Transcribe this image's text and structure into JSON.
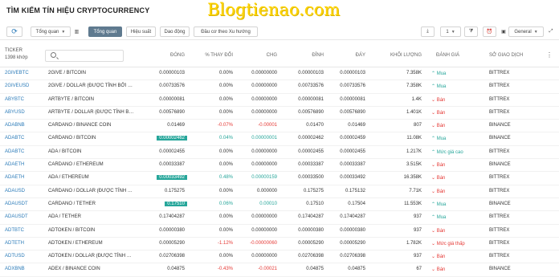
{
  "title": "TÌM KIẾM TÍN HIỆU CRYPTOCURRENCY",
  "watermark": "Blogtienao.com",
  "toolbar": {
    "overview_select": "Tổng quan",
    "tabs": [
      "Tổng quan",
      "Hiệu suất",
      "Dao động",
      "Đầu cơ theo Xu hướng"
    ],
    "interval": "1",
    "general_select": "General"
  },
  "header": {
    "ticker": "TICKER",
    "count": "1398 khớp",
    "columns": [
      "ĐÓNG",
      "% THAY ĐỔI",
      "CHG",
      "ĐỈNH",
      "ĐÁY",
      "KHỐI LƯỢNG",
      "ĐÁNH GIÁ",
      "SỞ GIAO DỊCH"
    ]
  },
  "rows": [
    {
      "sym": "2GIVEBTC",
      "desc": "2GIVE / BITCOIN",
      "last": "0.00000103",
      "chp": "0.00%",
      "chg": "0.00000000",
      "hi": "0.00000103",
      "lo": "0.00000103",
      "vol": "7.358K",
      "rat": "Mua",
      "exc": "BITTREX"
    },
    {
      "sym": "2GIVEUSD",
      "desc": "2GIVE / DOLLAR (ĐƯỢC TÍNH BỞI …",
      "last": "0.00733576",
      "chp": "0.00%",
      "chg": "0.00000000",
      "hi": "0.00733576",
      "lo": "0.00733576",
      "vol": "7.358K",
      "rat": "Mua",
      "exc": "BITTREX"
    },
    {
      "sym": "ABYBTC",
      "desc": "ARTBYTE / BITCOIN",
      "last": "0.00000081",
      "chp": "0.00%",
      "chg": "0.00000000",
      "hi": "0.00000081",
      "lo": "0.00000081",
      "vol": "1.4K",
      "rat": "Bán",
      "exc": "BITTREX"
    },
    {
      "sym": "ABYUSD",
      "desc": "ARTBYTE / DOLLAR (ĐƯỢC TÍNH B…",
      "last": "0.00576890",
      "chp": "0.00%",
      "chg": "0.00000000",
      "hi": "0.00576890",
      "lo": "0.00576890",
      "vol": "1.401K",
      "rat": "Bán",
      "exc": "BITTREX"
    },
    {
      "sym": "ADABNB",
      "desc": "CARDANO / BINANCE COIN",
      "last": "0.01469",
      "chp": "-0.07%",
      "chg": "-0.00001",
      "hi": "0.01470",
      "lo": "0.01469",
      "vol": "807",
      "rat": "Bán",
      "exc": "BINANCE"
    },
    {
      "sym": "ADABTC",
      "desc": "CARDANO / BITCOIN",
      "last": "0.00002462",
      "chp": "0.04%",
      "chg": "0.00000001",
      "hi": "0.00002462",
      "lo": "0.00002459",
      "vol": "11.08K",
      "rat": "Mua",
      "exc": "BINANCE"
    },
    {
      "sym": "ADABTC",
      "desc": "ADA / BITCOIN",
      "last": "0.00002455",
      "chp": "0.00%",
      "chg": "0.00000000",
      "hi": "0.00002455",
      "lo": "0.00002455",
      "vol": "1.217K",
      "rat": "Mức giá cao",
      "exc": "BITTREX"
    },
    {
      "sym": "ADAETH",
      "desc": "CARDANO / ETHEREUM",
      "last": "0.00033387",
      "chp": "0.00%",
      "chg": "0.00000000",
      "hi": "0.00033387",
      "lo": "0.00033387",
      "vol": "3.515K",
      "rat": "Bán",
      "exc": "BINANCE"
    },
    {
      "sym": "ADAETH",
      "desc": "ADA / ETHEREUM",
      "last": "0.00033492",
      "chp": "0.48%",
      "chg": "0.00000159",
      "hi": "0.00033500",
      "lo": "0.00033492",
      "vol": "16.358K",
      "rat": "Bán",
      "exc": "BITTREX"
    },
    {
      "sym": "ADAUSD",
      "desc": "CARDANO / DOLLAR (ĐƯỢC TÍNH …",
      "last": "0.175275",
      "chp": "0.00%",
      "chg": "0.000000",
      "hi": "0.175275",
      "lo": "0.175132",
      "vol": "7.71K",
      "rat": "Bán",
      "exc": "BITTREX"
    },
    {
      "sym": "ADAUSDT",
      "desc": "CARDANO / TETHER",
      "last": "0.17510",
      "chp": "0.06%",
      "chg": "0.00010",
      "hi": "0.17510",
      "lo": "0.17504",
      "vol": "11.553K",
      "rat": "Mua",
      "exc": "BINANCE"
    },
    {
      "sym": "ADAUSDT",
      "desc": "ADA / TETHER",
      "last": "0.17404287",
      "chp": "0.00%",
      "chg": "0.00000000",
      "hi": "0.17404287",
      "lo": "0.17404287",
      "vol": "937",
      "rat": "Mua",
      "exc": "BITTREX"
    },
    {
      "sym": "ADTBTC",
      "desc": "ADTOKEN / BITCOIN",
      "last": "0.00000380",
      "chp": "0.00%",
      "chg": "0.00000000",
      "hi": "0.00000380",
      "lo": "0.00000380",
      "vol": "937",
      "rat": "Bán",
      "exc": "BITTREX"
    },
    {
      "sym": "ADTETH",
      "desc": "ADTOKEN / ETHEREUM",
      "last": "0.00005290",
      "chp": "-1.12%",
      "chg": "-0.00000060",
      "hi": "0.00005290",
      "lo": "0.00005290",
      "vol": "1.782K",
      "rat": "Mức giá thấp",
      "exc": "BITTREX"
    },
    {
      "sym": "ADTUSD",
      "desc": "ADTOKEN / DOLLAR (ĐƯỢC TÍNH …",
      "last": "0.02706398",
      "chp": "0.00%",
      "chg": "0.00000000",
      "hi": "0.02706398",
      "lo": "0.02706398",
      "vol": "937",
      "rat": "Bán",
      "exc": "BITTREX"
    },
    {
      "sym": "ADXBNB",
      "desc": "ADEX / BINANCE COIN",
      "last": "0.04875",
      "chp": "-0.43%",
      "chg": "-0.00021",
      "hi": "0.04875",
      "lo": "0.04875",
      "vol": "67",
      "rat": "Bán",
      "exc": "BINANCE"
    }
  ],
  "colors": {
    "positive": "#26a69a",
    "negative": "#e53935",
    "ticker": "#2a7ab8",
    "active_tab": "#5f7a8f"
  }
}
